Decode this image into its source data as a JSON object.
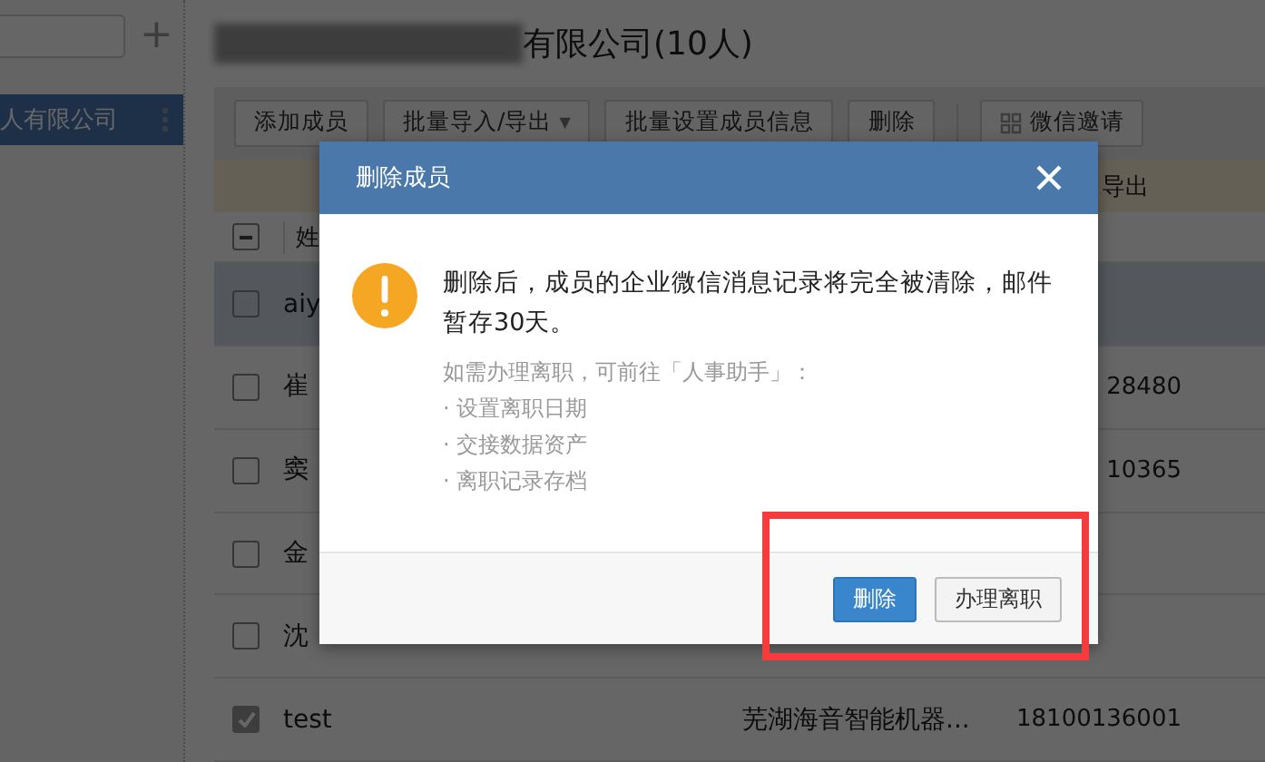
{
  "sidebar": {
    "add_button": "+",
    "items": [
      {
        "label": "人有限公司",
        "selected": true
      }
    ]
  },
  "header": {
    "title": "有限公司(10人)"
  },
  "toolbar": [
    {
      "kind": "button",
      "label": "添加成员"
    },
    {
      "kind": "dropdown",
      "label": "批量导入/导出",
      "caret": "▼"
    },
    {
      "kind": "button",
      "label": "批量设置成员信息"
    },
    {
      "kind": "button",
      "label": "删除"
    },
    {
      "kind": "icon",
      "label": "微信邀请"
    }
  ],
  "banner": {
    "text": "导出"
  },
  "table": {
    "columns": [
      "姓"
    ],
    "header_indeterminate": true,
    "rows": [
      {
        "name": "aiy",
        "checked": false,
        "hovered": true,
        "company": "",
        "phone": ""
      },
      {
        "name": "崔",
        "checked": false,
        "hovered": false,
        "company": "",
        "phone": "28480"
      },
      {
        "name": "窦",
        "checked": false,
        "hovered": false,
        "company": "",
        "phone": "10365"
      },
      {
        "name": "金",
        "checked": false,
        "hovered": false,
        "company": "",
        "phone": ""
      },
      {
        "name": "沈",
        "checked": false,
        "hovered": false,
        "company": "",
        "phone": ""
      },
      {
        "name": "test",
        "checked": true,
        "hovered": false,
        "company": "芜湖海音智能机器...",
        "phone": "18100136001"
      }
    ]
  },
  "dialog": {
    "title": "删除成员",
    "message": "删除后，成员的企业微信消息记录将完全被清除，邮件暂存30天。",
    "hint": "如需办理离职，可前往「人事助手」：",
    "steps": [
      "· 设置离职日期",
      "· 交接数据资产",
      "· 离职记录存档"
    ],
    "buttons": [
      {
        "kind": "primary",
        "label": "删除"
      },
      {
        "kind": "default",
        "label": "办理离职"
      }
    ]
  }
}
